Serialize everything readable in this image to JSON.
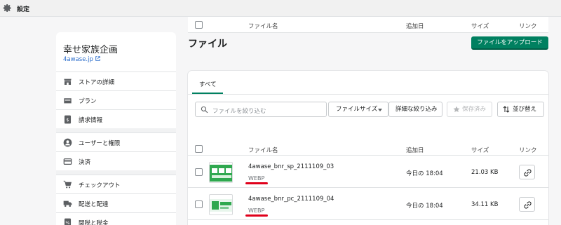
{
  "topbar": {
    "title": "設定"
  },
  "store": {
    "name": "幸せ家族企画",
    "link": "4awase.jp"
  },
  "menu": [
    {
      "label": "ストアの詳細",
      "icon": "store-icon"
    },
    {
      "label": "プラン",
      "icon": "plan-icon"
    },
    {
      "label": "請求情報",
      "icon": "billing-icon"
    },
    {
      "label": "ユーザーと権限",
      "icon": "user-icon"
    },
    {
      "label": "決済",
      "icon": "payment-icon"
    },
    {
      "label": "チェックアウト",
      "icon": "cart-icon"
    },
    {
      "label": "配送と配達",
      "icon": "truck-icon"
    },
    {
      "label": "関税と税金",
      "icon": "tax-icon"
    }
  ],
  "sticky_header": {
    "file_name": "ファイル名",
    "added": "追加日",
    "size": "サイズ",
    "link": "リンク"
  },
  "page": {
    "title": "ファイル",
    "upload_button": "ファイルをアップロード"
  },
  "tabs": [
    "すべて"
  ],
  "toolbar": {
    "search_placeholder": "ファイルを絞り込む",
    "file_size": "ファイルサイズ",
    "detail_filter": "詳細な絞り込み",
    "saved": "保存済み",
    "sort": "並び替え"
  },
  "table": {
    "headers": {
      "file_name": "ファイル名",
      "added": "追加日",
      "size": "サイズ",
      "link": "リンク"
    },
    "rows": [
      {
        "name": "4awase_bnr_sp_2111109_03",
        "type": "WEBP",
        "date": "今日の 18:04",
        "size": "21.03 KB"
      },
      {
        "name": "4awase_bnr_pc_2111109_04",
        "type": "WEBP",
        "date": "今日の 18:04",
        "size": "34.11 KB"
      }
    ]
  },
  "colors": {
    "primary": "#008060",
    "link": "#2c6ecb",
    "annotation": "#e0001b"
  }
}
